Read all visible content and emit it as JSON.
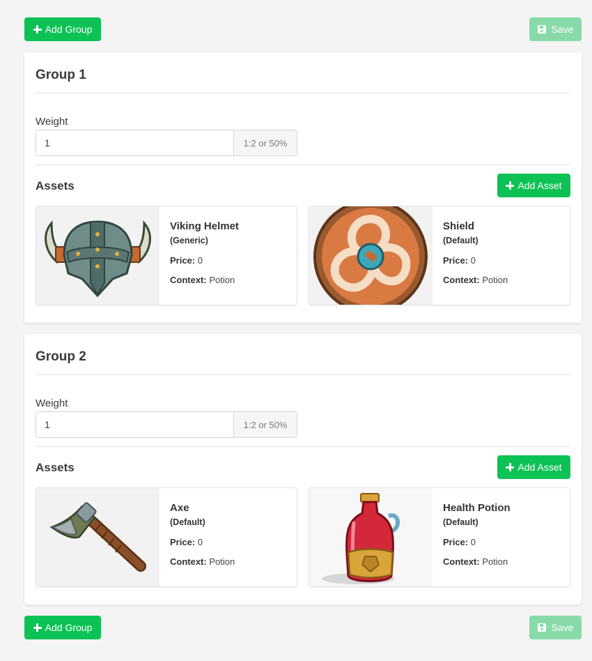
{
  "toolbar": {
    "add_group_label": "Add Group",
    "save_label": "Save"
  },
  "groups": [
    {
      "title": "Group 1",
      "weight_label": "Weight",
      "weight_value": "1",
      "weight_hint": "1:2 or 50%",
      "assets_label": "Assets",
      "add_asset_label": "Add Asset",
      "assets": [
        {
          "name": "Viking Helmet",
          "variant": "(Generic)",
          "price_label": "Price:",
          "price": "0",
          "context_label": "Context:",
          "context": "Potion",
          "icon": "viking-helmet-icon"
        },
        {
          "name": "Shield",
          "variant": "(Default)",
          "price_label": "Price:",
          "price": "0",
          "context_label": "Context:",
          "context": "Potion",
          "icon": "shield-icon"
        }
      ]
    },
    {
      "title": "Group 2",
      "weight_label": "Weight",
      "weight_value": "1",
      "weight_hint": "1:2 or 50%",
      "assets_label": "Assets",
      "add_asset_label": "Add Asset",
      "assets": [
        {
          "name": "Axe",
          "variant": "(Default)",
          "price_label": "Price:",
          "price": "0",
          "context_label": "Context:",
          "context": "Potion",
          "icon": "axe-icon"
        },
        {
          "name": "Health Potion",
          "variant": "(Default)",
          "price_label": "Price:",
          "price": "0",
          "context_label": "Context:",
          "context": "Potion",
          "icon": "health-potion-icon"
        }
      ]
    }
  ],
  "colors": {
    "primary_green": "#0dc254",
    "save_disabled_green": "#88dba9",
    "background": "#f4f4f4"
  }
}
